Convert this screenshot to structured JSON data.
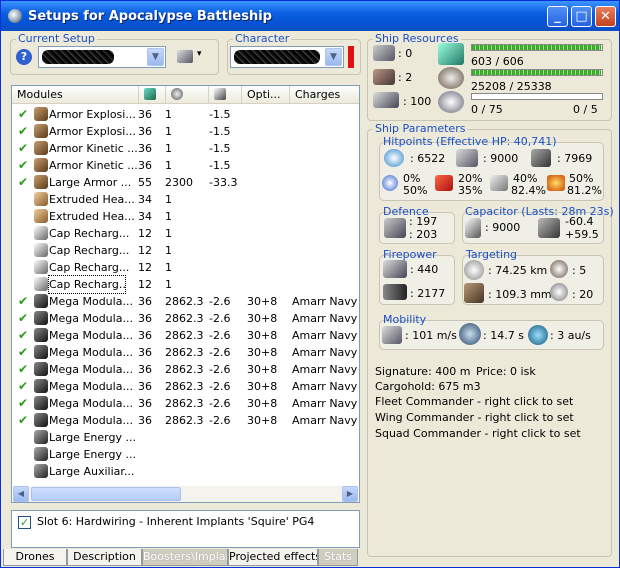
{
  "window": {
    "title": "Setups for Apocalypse Battleship",
    "minimize": "_",
    "maximize": "□",
    "close": "✕"
  },
  "current_setup": {
    "label": "Current Setup",
    "help": "?",
    "arrow": "▾"
  },
  "character": {
    "label": "Character"
  },
  "columns": [
    "Modules",
    "",
    "",
    "",
    "Opti...",
    "Charges"
  ],
  "modules": [
    {
      "checked": true,
      "icon": "armor",
      "name": "Armor Explosi...",
      "c1": "36",
      "c2": "1",
      "c3": "-1.5",
      "c4": "",
      "c5": ""
    },
    {
      "checked": true,
      "icon": "armor",
      "name": "Armor Explosi...",
      "c1": "36",
      "c2": "1",
      "c3": "-1.5",
      "c4": "",
      "c5": ""
    },
    {
      "checked": true,
      "icon": "armor",
      "name": "Armor Kinetic ...",
      "c1": "36",
      "c2": "1",
      "c3": "-1.5",
      "c4": "",
      "c5": ""
    },
    {
      "checked": true,
      "icon": "armor",
      "name": "Armor Kinetic ...",
      "c1": "36",
      "c2": "1",
      "c3": "-1.5",
      "c4": "",
      "c5": ""
    },
    {
      "checked": true,
      "icon": "armor",
      "name": "Large Armor ...",
      "c1": "55",
      "c2": "2300",
      "c3": "-33.3",
      "c4": "",
      "c5": ""
    },
    {
      "checked": false,
      "icon": "heat",
      "name": "Extruded Hea...",
      "c1": "34",
      "c2": "1",
      "c3": "",
      "c4": "",
      "c5": ""
    },
    {
      "checked": false,
      "icon": "heat",
      "name": "Extruded Hea...",
      "c1": "34",
      "c2": "1",
      "c3": "",
      "c4": "",
      "c5": ""
    },
    {
      "checked": false,
      "icon": "cap",
      "name": "Cap Recharg...",
      "c1": "12",
      "c2": "1",
      "c3": "",
      "c4": "",
      "c5": ""
    },
    {
      "checked": false,
      "icon": "cap",
      "name": "Cap Recharg...",
      "c1": "12",
      "c2": "1",
      "c3": "",
      "c4": "",
      "c5": ""
    },
    {
      "checked": false,
      "icon": "cap",
      "name": "Cap Recharg...",
      "c1": "12",
      "c2": "1",
      "c3": "",
      "c4": "",
      "c5": ""
    },
    {
      "checked": false,
      "icon": "cap",
      "name": "Cap Recharg...",
      "c1": "12",
      "c2": "1",
      "c3": "",
      "c4": "",
      "c5": "",
      "selected": true
    },
    {
      "checked": true,
      "icon": "laser",
      "name": "Mega Modula...",
      "c1": "36",
      "c2": "2862.3",
      "c3": "-2.6",
      "c4": "30+8",
      "c5": "Amarr Navy G"
    },
    {
      "checked": true,
      "icon": "laser",
      "name": "Mega Modula...",
      "c1": "36",
      "c2": "2862.3",
      "c3": "-2.6",
      "c4": "30+8",
      "c5": "Amarr Navy G"
    },
    {
      "checked": true,
      "icon": "laser",
      "name": "Mega Modula...",
      "c1": "36",
      "c2": "2862.3",
      "c3": "-2.6",
      "c4": "30+8",
      "c5": "Amarr Navy G"
    },
    {
      "checked": true,
      "icon": "laser",
      "name": "Mega Modula...",
      "c1": "36",
      "c2": "2862.3",
      "c3": "-2.6",
      "c4": "30+8",
      "c5": "Amarr Navy G"
    },
    {
      "checked": true,
      "icon": "laser",
      "name": "Mega Modula...",
      "c1": "36",
      "c2": "2862.3",
      "c3": "-2.6",
      "c4": "30+8",
      "c5": "Amarr Navy G"
    },
    {
      "checked": true,
      "icon": "laser",
      "name": "Mega Modula...",
      "c1": "36",
      "c2": "2862.3",
      "c3": "-2.6",
      "c4": "30+8",
      "c5": "Amarr Navy G"
    },
    {
      "checked": true,
      "icon": "laser",
      "name": "Mega Modula...",
      "c1": "36",
      "c2": "2862.3",
      "c3": "-2.6",
      "c4": "30+8",
      "c5": "Amarr Navy G"
    },
    {
      "checked": true,
      "icon": "laser",
      "name": "Mega Modula...",
      "c1": "36",
      "c2": "2862.3",
      "c3": "-2.6",
      "c4": "30+8",
      "c5": "Amarr Navy G"
    },
    {
      "checked": false,
      "icon": "rig",
      "name": "Large Energy ...",
      "c1": "",
      "c2": "",
      "c3": "",
      "c4": "",
      "c5": ""
    },
    {
      "checked": false,
      "icon": "rig",
      "name": "Large Energy ...",
      "c1": "",
      "c2": "",
      "c3": "",
      "c4": "",
      "c5": ""
    },
    {
      "checked": false,
      "icon": "rig",
      "name": "Large Auxiliar...",
      "c1": "",
      "c2": "",
      "c3": "",
      "c4": "",
      "c5": ""
    }
  ],
  "implant": {
    "checked": true,
    "text": "Slot 6: Hardwiring - Inherent Implants 'Squire' PG4"
  },
  "tabs": [
    {
      "label": "Drones",
      "disabled": false
    },
    {
      "label": "Description",
      "disabled": false
    },
    {
      "label": "Boosters\\Implants",
      "disabled": true
    },
    {
      "label": "Projected effects",
      "disabled": false
    },
    {
      "label": "Stats",
      "disabled": true
    }
  ],
  "resources": {
    "label": "Ship Resources",
    "hardpoints": [
      ": 0",
      ": 2",
      ": 100"
    ],
    "cpu_text": "603 / 606",
    "cpu_fraction": 0.995,
    "pg_text": "25208 / 25338",
    "pg_fraction": 0.995,
    "drone_text": "0 / 75",
    "drone_fraction": 0,
    "drone_right": "0 / 5"
  },
  "parameters": {
    "label": "Ship Parameters",
    "hitpoints": {
      "label": "Hitpoints (Effective HP: 40,741)",
      "shield": ": 6522",
      "armor": ": 9000",
      "structure": ": 7969",
      "res": [
        [
          "0%",
          "50%"
        ],
        [
          "20%",
          "35%"
        ],
        [
          "40%",
          "82.4%"
        ],
        [
          "50%",
          "81.2%"
        ]
      ]
    },
    "defence": {
      "label": "Defence",
      "top": ": 197",
      "bottom": ": 203"
    },
    "capacitor": {
      "label": "Capacitor (Lasts: 28m 23s)",
      "amount": ": 9000",
      "top": "-60.4",
      "bottom": "+59.5"
    },
    "firepower": {
      "label": "Firepower",
      "volley": ": 440",
      "dps": ": 2177"
    },
    "targeting": {
      "label": "Targeting",
      "range": ": 74.25 km",
      "targets": ": 5",
      "scan": ": 109.3 mm",
      "sensor": ": 20"
    },
    "mobility": {
      "label": "Mobility",
      "speed": ": 101 m/s",
      "align": ": 14.7 s",
      "warp": ": 3 au/s"
    },
    "info": {
      "signature": "Signature: 400 m",
      "price": "Price: 0 isk",
      "cargo": "Cargohold: 675 m3",
      "fleet": "Fleet Commander - right click to set",
      "wing": "Wing Commander - right click to set",
      "squad": "Squad Commander - right click to set"
    }
  }
}
